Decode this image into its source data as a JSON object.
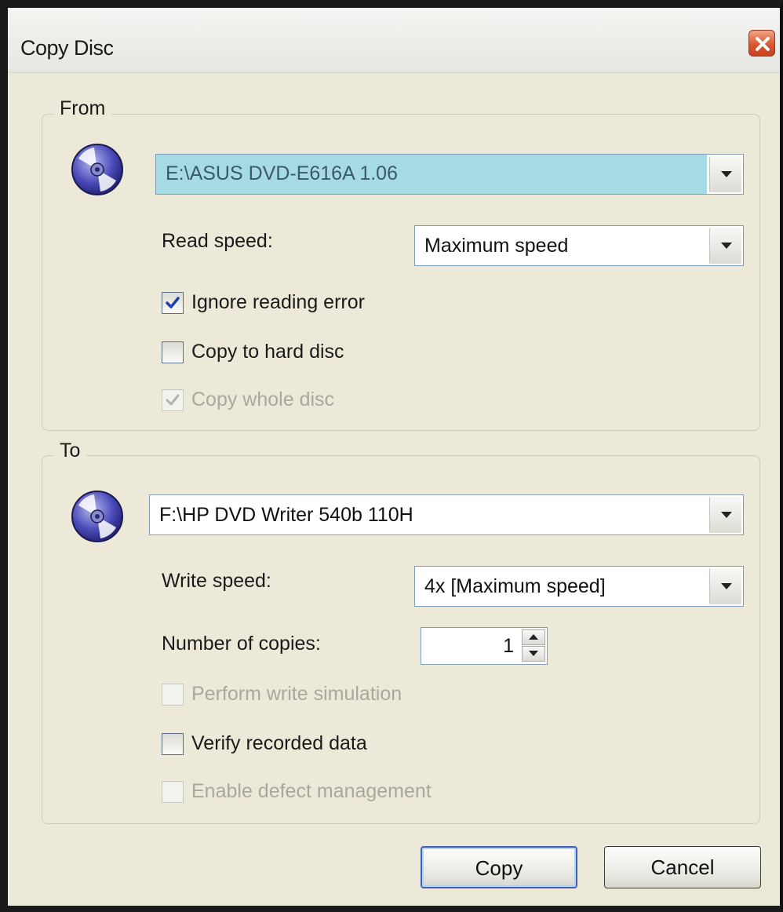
{
  "window": {
    "title": "Copy Disc",
    "close_icon": "close-icon"
  },
  "from": {
    "group_label": "From",
    "icon": "disc-icon",
    "source_drive": "E:\\ASUS DVD-E616A 1.06",
    "read_speed_label": "Read speed:",
    "read_speed_value": "Maximum speed",
    "options": [
      {
        "label": "Ignore reading error",
        "checked": true,
        "enabled": true
      },
      {
        "label": "Copy to hard disc",
        "checked": false,
        "enabled": true
      },
      {
        "label": "Copy whole disc",
        "checked": true,
        "enabled": false
      }
    ]
  },
  "to": {
    "group_label": "To",
    "icon": "disc-icon",
    "target_drive": "F:\\HP DVD Writer 540b 110H",
    "write_speed_label": "Write speed:",
    "write_speed_value": "4x [Maximum speed]",
    "copies_label": "Number of copies:",
    "copies_value": "1",
    "options": [
      {
        "label": "Perform write simulation",
        "checked": false,
        "enabled": false
      },
      {
        "label": "Verify recorded data",
        "checked": false,
        "enabled": true
      },
      {
        "label": "Enable defect management",
        "checked": false,
        "enabled": false
      }
    ]
  },
  "buttons": {
    "copy_label": "Copy",
    "cancel_label": "Cancel"
  },
  "colors": {
    "dialog_background": "#ece9d8",
    "selection_highlight": "#a6dbe4",
    "close_button": "#d9582f",
    "default_button_border": "#3f63b5"
  }
}
